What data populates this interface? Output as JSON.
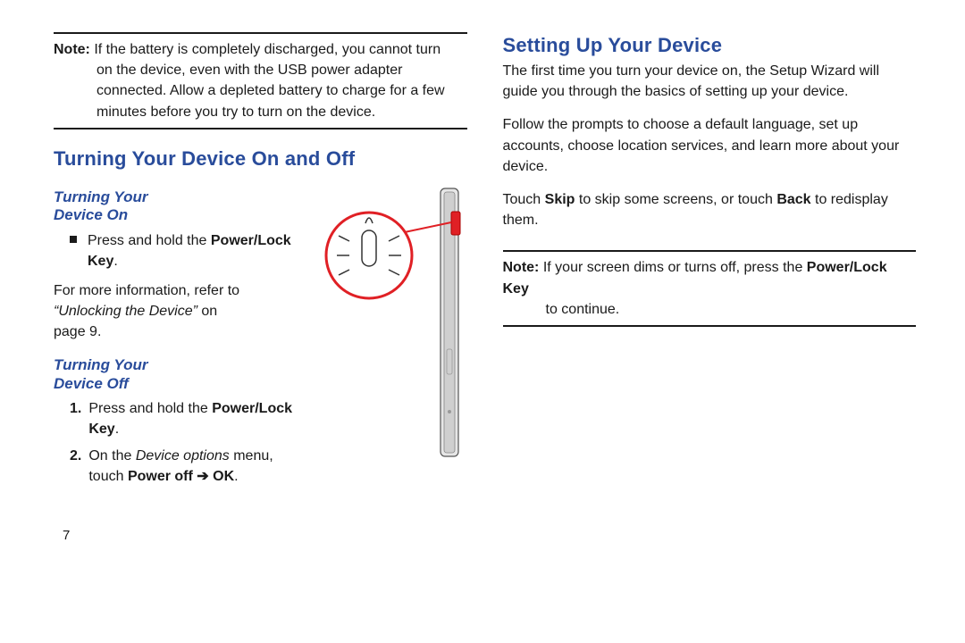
{
  "left": {
    "note1": {
      "label": "Note:",
      "line1": "If the battery is completely discharged, you cannot turn",
      "cont": "on the device, even with the USB power adapter connected. Allow a depleted battery to charge for a few minutes before you try to turn on the device."
    },
    "h_onoff": "Turning Your Device On and Off",
    "h_on_l1": "Turning Your",
    "h_on_l2": "Device On",
    "on_bullet_pre": "Press and hold the ",
    "on_bullet_bold": "Power/Lock Key",
    "on_bullet_post": ".",
    "more_pre": "For more information, refer to ",
    "more_ital": "“Unlocking the Device”",
    "more_on": " on",
    "more_page": "page 9.",
    "h_off_l1": "Turning Your",
    "h_off_l2": "Device Off",
    "off1_num": "1.",
    "off1_pre": "Press and hold the ",
    "off1_bold": "Power/Lock Key",
    "off1_post": ".",
    "off2_num": "2.",
    "off2_pre": "On the ",
    "off2_ital": "Device options",
    "off2_mid": " menu, touch ",
    "off2_bold": "Power off ➔ OK",
    "off2_post": ".",
    "page_number": "7"
  },
  "right": {
    "h_setup": "Setting Up Your Device",
    "p1": "The first time you turn your device on, the Setup Wizard will guide you through the basics of setting up your device.",
    "p2": "Follow the prompts to choose a default language, set up accounts, choose location services, and learn more about your device.",
    "p3_pre": "Touch ",
    "p3_skip": "Skip",
    "p3_mid": " to skip some screens, or touch ",
    "p3_back": "Back",
    "p3_post": " to redisplay them.",
    "note2": {
      "label": "Note:",
      "line1": "If your screen dims or turns off, press the ",
      "bold": "Power/Lock Key",
      "post": " to continue."
    }
  },
  "icons": {
    "device_figure": "device-power-button-illustration"
  }
}
